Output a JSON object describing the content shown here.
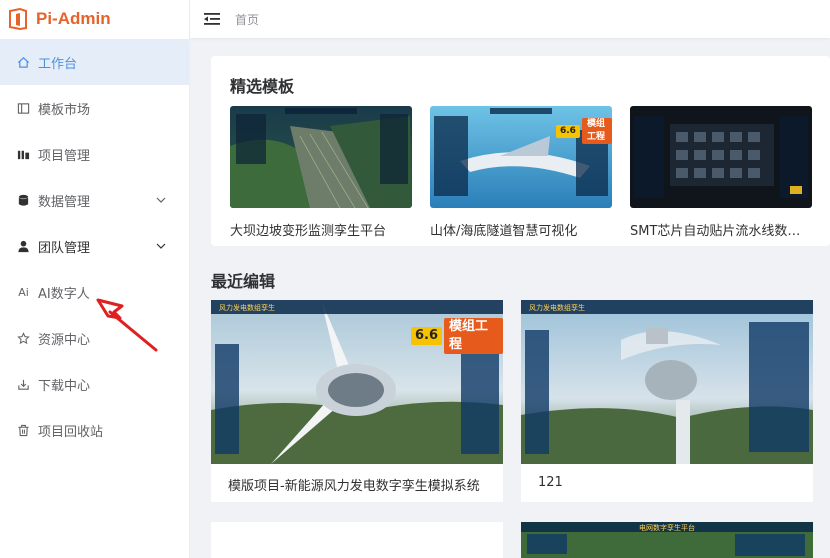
{
  "app": {
    "name": "Pi-Admin",
    "brand_color": "#e6632b",
    "accent_color": "#4f8fe0"
  },
  "header": {
    "breadcrumb": "首页",
    "menu_toggle_icon": "menu-fold-icon"
  },
  "sidebar": {
    "items": [
      {
        "label": "工作台",
        "icon": "home-icon",
        "active": true
      },
      {
        "label": "模板市场",
        "icon": "template-icon"
      },
      {
        "label": "项目管理",
        "icon": "bar-chart-icon"
      },
      {
        "label": "数据管理",
        "icon": "database-icon",
        "expandable": true
      },
      {
        "label": "团队管理",
        "icon": "user-icon",
        "expandable": true
      },
      {
        "label": "AI数字人",
        "icon": "ai-icon",
        "prefix": "Ai"
      },
      {
        "label": "资源中心",
        "icon": "star-icon"
      },
      {
        "label": "下载中心",
        "icon": "download-icon"
      },
      {
        "label": "项目回收站",
        "icon": "trash-icon"
      }
    ]
  },
  "featured": {
    "title": "精选模板",
    "items": [
      {
        "caption": "大坝边坡变形监测孪生平台"
      },
      {
        "caption": "山体/海底隧道智慧可视化",
        "badge_num": "6.6",
        "badge_text": "模组工程"
      },
      {
        "caption": "SMT芯片自动贴片流水线数字孪生"
      }
    ]
  },
  "recent": {
    "title": "最近编辑",
    "items": [
      {
        "caption": "模版项目-新能源风力发电数字孪生模拟系统",
        "badge_num": "6.6",
        "badge_text": "模组工程",
        "thumb_title": "风力发电数组孪生"
      },
      {
        "caption": "121",
        "thumb_title": "风力发电数组孪生"
      }
    ],
    "partial_thumb_title": "电网数字孪生平台"
  }
}
